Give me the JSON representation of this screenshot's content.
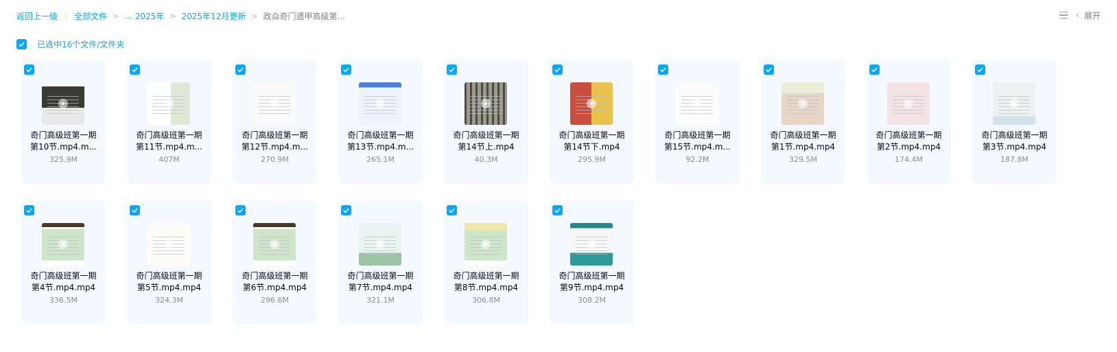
{
  "breadcrumb": {
    "back": "返回上一级",
    "all_files": "全部文件",
    "ellipsis": "...",
    "year": "2025年",
    "month": "2025年12月更新",
    "current": "政焱奇门遁甲高级第..."
  },
  "toolbar": {
    "expand_label": "展开"
  },
  "selection": {
    "text": "已选中16个文件/文件夹"
  },
  "colors": {
    "accent": "#06a7ff",
    "card_bg": "#f3f9fe"
  },
  "files": [
    {
      "line1": "奇门高级班第一期",
      "line2": "第10节.mp4.m...",
      "size": "325.9M",
      "thumb": "t-dark"
    },
    {
      "line1": "奇门高级班第一期",
      "line2": "第11节.mp4.m...",
      "size": "407M",
      "thumb": "t-doc-green"
    },
    {
      "line1": "奇门高级班第一期",
      "line2": "第12节.mp4.m...",
      "size": "270.9M",
      "thumb": "t-doc-red"
    },
    {
      "line1": "奇门高级班第一期",
      "line2": "第13节.mp4.m...",
      "size": "265.1M",
      "thumb": "t-blue"
    },
    {
      "line1": "奇门高级班第一期",
      "line2": "第14节上.mp4",
      "size": "40.3M",
      "thumb": "t-fence"
    },
    {
      "line1": "奇门高级班第一期",
      "line2": "第14节下.mp4",
      "size": "295.9M",
      "thumb": "t-colorful"
    },
    {
      "line1": "奇门高级班第一期",
      "line2": "第15节.mp4.m...",
      "size": "92.2M",
      "thumb": "t-doc-white"
    },
    {
      "line1": "奇门高级班第一期",
      "line2": "第1节.mp4.mp4",
      "size": "329.5M",
      "thumb": "t-landscape-a"
    },
    {
      "line1": "奇门高级班第一期",
      "line2": "第2节.mp4.mp4",
      "size": "174.4M",
      "thumb": "t-landscape-b"
    },
    {
      "line1": "奇门高级班第一期",
      "line2": "第3节.mp4.mp4",
      "size": "187.8M",
      "thumb": "t-landscape-c"
    },
    {
      "line1": "奇门高级班第一期",
      "line2": "第4节.mp4.mp4",
      "size": "336.5M",
      "thumb": "t-table-green"
    },
    {
      "line1": "奇门高级班第一期",
      "line2": "第5节.mp4.mp4",
      "size": "324.3M",
      "thumb": "t-handwrite"
    },
    {
      "line1": "奇门高级班第一期",
      "line2": "第6节.mp4.mp4",
      "size": "296.6M",
      "thumb": "t-table-green"
    },
    {
      "line1": "奇门高级班第一期",
      "line2": "第7节.mp4.mp4",
      "size": "321.1M",
      "thumb": "t-landscape-d"
    },
    {
      "line1": "奇门高级班第一期",
      "line2": "第8节.mp4.mp4",
      "size": "306.8M",
      "thumb": "t-table-yellow"
    },
    {
      "line1": "奇门高级班第一期",
      "line2": "第9节.mp4.mp4",
      "size": "308.2M",
      "thumb": "t-teal"
    }
  ]
}
